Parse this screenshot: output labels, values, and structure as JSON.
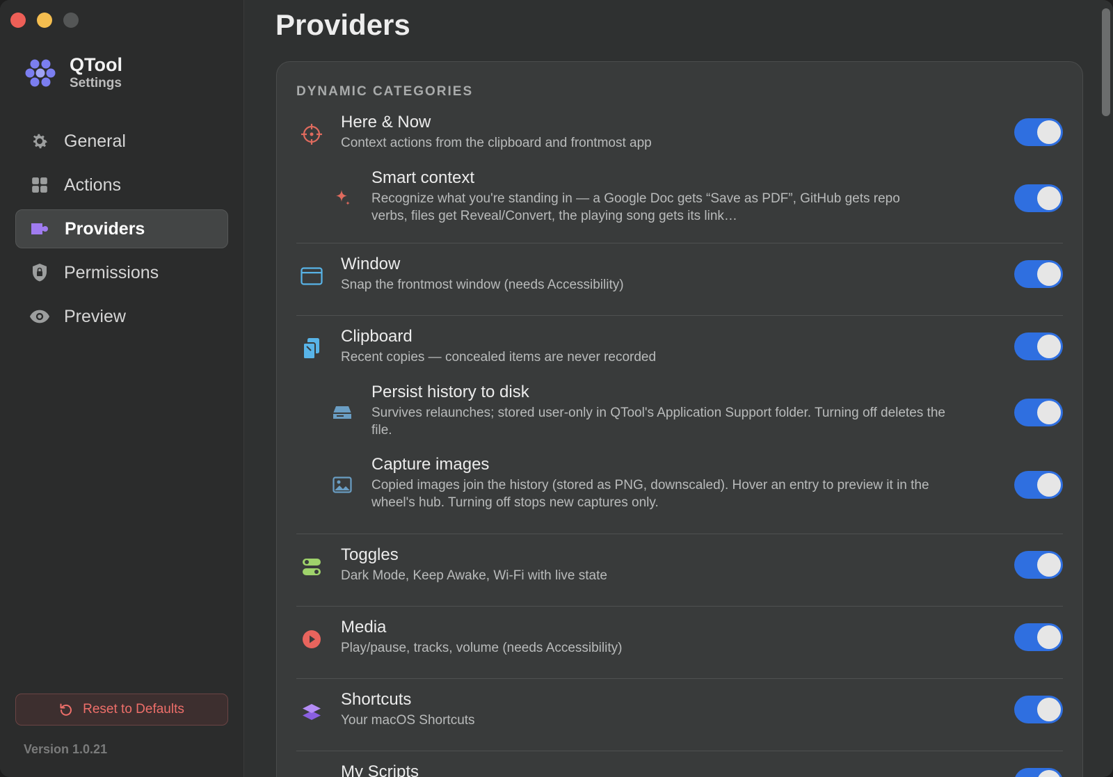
{
  "app": {
    "name": "QTool",
    "subtitle": "Settings",
    "version": "Version 1.0.21"
  },
  "sidebar": {
    "items": [
      {
        "label": "General",
        "icon": "gear-icon",
        "active": false
      },
      {
        "label": "Actions",
        "icon": "grid-icon",
        "active": false
      },
      {
        "label": "Providers",
        "icon": "puzzle-icon",
        "active": true
      },
      {
        "label": "Permissions",
        "icon": "shield-lock-icon",
        "active": false
      },
      {
        "label": "Preview",
        "icon": "eye-icon",
        "active": false
      }
    ],
    "reset_label": "Reset to Defaults"
  },
  "main": {
    "title": "Providers",
    "section_title": "DYNAMIC CATEGORIES",
    "providers": [
      {
        "title": "Here & Now",
        "desc": "Context actions from the clipboard and frontmost app",
        "icon": "crosshair-icon",
        "enabled": true
      },
      {
        "title": "Smart context",
        "desc": "Recognize what you're standing in — a Google Doc gets “Save as PDF”, GitHub gets repo verbs, files get Reveal/Convert, the playing song gets its link…",
        "icon": "sparkle-icon",
        "enabled": true
      },
      {
        "title": "Window",
        "desc": "Snap the frontmost window (needs Accessibility)",
        "icon": "window-icon",
        "enabled": true
      },
      {
        "title": "Clipboard",
        "desc": "Recent copies — concealed items are never recorded",
        "icon": "clipboard-icon",
        "enabled": true
      },
      {
        "title": "Persist history to disk",
        "desc": "Survives relaunches; stored user-only in QTool's Application Support folder. Turning off deletes the file.",
        "icon": "disk-icon",
        "enabled": true
      },
      {
        "title": "Capture images",
        "desc": "Copied images join the history (stored as PNG, downscaled). Hover an entry to preview it in the wheel's hub. Turning off stops new captures only.",
        "icon": "image-icon",
        "enabled": true
      },
      {
        "title": "Toggles",
        "desc": "Dark Mode, Keep Awake, Wi-Fi with live state",
        "icon": "switches-icon",
        "enabled": true
      },
      {
        "title": "Media",
        "desc": "Play/pause, tracks, volume (needs Accessibility)",
        "icon": "play-icon",
        "enabled": true
      },
      {
        "title": "Shortcuts",
        "desc": "Your macOS Shortcuts",
        "icon": "layers-icon",
        "enabled": true
      },
      {
        "title": "My Scripts",
        "desc": "",
        "icon": "script-icon",
        "enabled": true
      }
    ]
  },
  "colors": {
    "accent": "#2f6fe0",
    "danger": "#ee6f6a",
    "logo": "#7b7ef0"
  }
}
